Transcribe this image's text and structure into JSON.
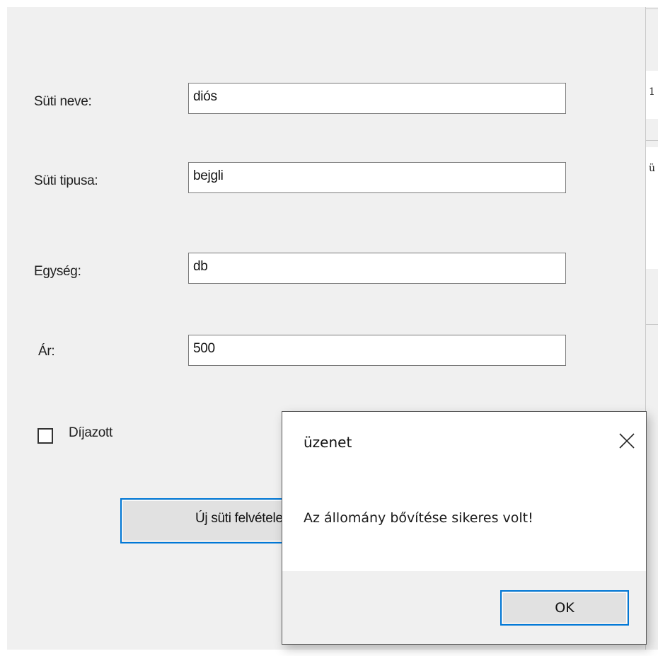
{
  "form": {
    "fields": [
      {
        "label": "Süti neve:",
        "value": "diós"
      },
      {
        "label": "Süti tipusa:",
        "value": "bejgli"
      },
      {
        "label": "Egység:",
        "value": "db"
      },
      {
        "label": "Ár:",
        "value": "500"
      }
    ],
    "checkbox": {
      "label": "Díjazott",
      "checked": false
    },
    "submit_button": "Új süti felvétele"
  },
  "side_panel": {
    "glyphs": [
      "1",
      "ü"
    ]
  },
  "dialog": {
    "title": "üzenet",
    "message": "Az állomány bővítése sikeres volt!",
    "ok_label": "OK",
    "close_icon": "close-icon"
  },
  "colors": {
    "accent": "#0078d7",
    "window_bg": "#f0f0f0",
    "button_bg": "#e1e1e1"
  }
}
